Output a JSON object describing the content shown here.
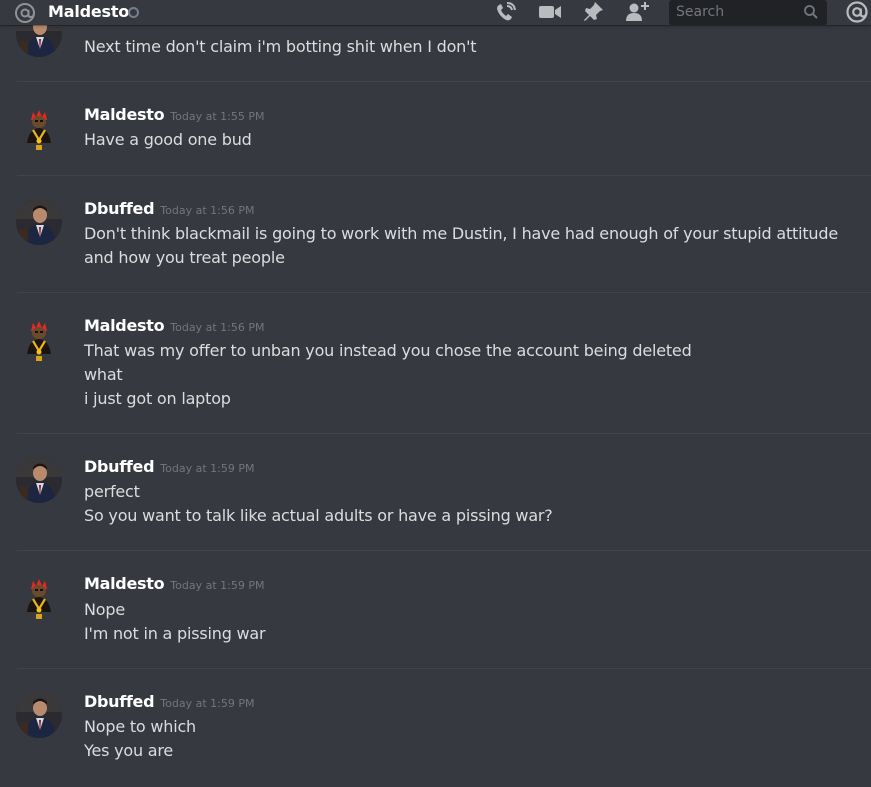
{
  "header": {
    "channel_name": "Maldesto",
    "search_placeholder": "Search"
  },
  "icons": {
    "at": "at-icon",
    "status": "status-offline-icon",
    "call": "phone-call-icon",
    "video": "video-camera-icon",
    "pin": "pin-icon",
    "add_user": "add-user-icon",
    "search": "search-icon",
    "mentions": "mentions-icon"
  },
  "colors": {
    "background": "#36393f",
    "text": "#dcddde",
    "username": "#ffffff",
    "timestamp": "#72767d",
    "search_bg": "#202225"
  },
  "messages": [
    {
      "lines": [
        "Next time don't claim i'm botting shit when I don't"
      ]
    },
    {
      "author": "Maldesto",
      "timestamp": "Today at 1:55 PM",
      "lines": [
        "Have a good one bud"
      ]
    },
    {
      "author": "Dbuffed",
      "timestamp": "Today at 1:56 PM",
      "lines": [
        "Don't think blackmail is going to work with me Dustin, I have had enough of your stupid attitude and how you treat people"
      ]
    },
    {
      "author": "Maldesto",
      "timestamp": "Today at 1:56 PM",
      "lines": [
        "That was my offer to unban you instead you chose the account being deleted",
        "what",
        "i just got on laptop"
      ]
    },
    {
      "author": "Dbuffed",
      "timestamp": "Today at 1:59 PM",
      "lines": [
        "perfect",
        "So you want to talk like actual adults or have a pissing war?"
      ]
    },
    {
      "author": "Maldesto",
      "timestamp": "Today at 1:59 PM",
      "lines": [
        "Nope",
        "I'm not in a pissing war"
      ]
    },
    {
      "author": "Dbuffed",
      "timestamp": "Today at 1:59 PM",
      "lines": [
        "Nope to which",
        "Yes you are"
      ]
    }
  ]
}
